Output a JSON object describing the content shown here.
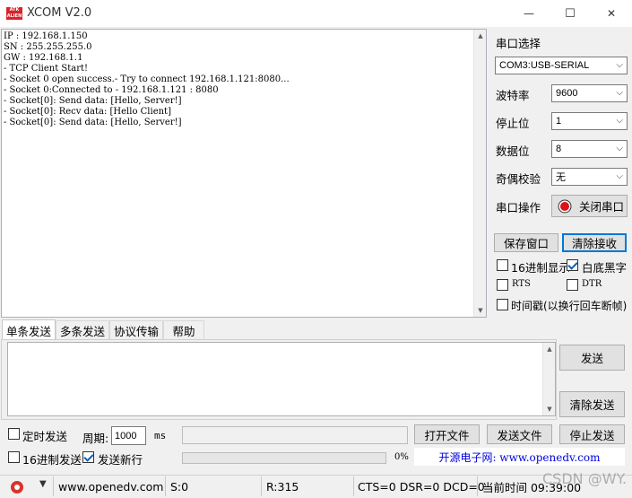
{
  "app": {
    "logo_text": "ATK ALIENTEK",
    "title": "XCOM V2.0",
    "minimize_glyph": "—",
    "maximize_glyph": "☐",
    "close_glyph": "✕"
  },
  "receive": {
    "text": "IP : 192.168.1.150\nSN : 255.255.255.0\nGW : 192.168.1.1\n- TCP Client Start!\n- Socket 0 open success.- Try to connect 192.168.1.121:8080...\n- Socket 0:Connected to - 192.168.1.121 : 8080\n- Socket[0]: Send data: [Hello, Server!]\n- Socket[0]: Recv data: [Hello Client]\n- Socket[0]: Send data: [Hello, Server!]"
  },
  "serial": {
    "section_label": "串口选择",
    "port_value": "COM3:USB-SERIAL",
    "baud_label": "波特率",
    "baud_value": "9600",
    "stop_label": "停止位",
    "stop_value": "1",
    "data_label": "数据位",
    "data_value": "8",
    "parity_label": "奇偶校验",
    "parity_value": "无",
    "op_label": "串口操作",
    "close_port_label": "关闭串口",
    "status_color": "#e0101a"
  },
  "actions": {
    "save_window": "保存窗口",
    "clear_receive": "清除接收"
  },
  "options": {
    "hex_display": "16进制显示",
    "hex_display_checked": false,
    "white_bg": "白底黑字",
    "white_bg_checked": true,
    "rts": "RTS",
    "rts_checked": false,
    "dtr": "DTR",
    "dtr_checked": false,
    "timestamp": "时间戳(以换行回车断帧)",
    "timestamp_checked": false
  },
  "tabs": [
    "单条发送",
    "多条发送",
    "协议传输",
    "帮助"
  ],
  "send": {
    "send_button": "发送",
    "clear_send_button": "清除发送",
    "timed_send": "定时发送",
    "timed_send_checked": false,
    "period_label": "周期:",
    "period_value": "1000",
    "period_unit": "ms",
    "open_file": "打开文件",
    "send_file": "发送文件",
    "stop_send": "停止发送",
    "hex_send": "16进制发送",
    "hex_send_checked": false,
    "send_newline": "发送新行",
    "send_newline_checked": true,
    "progress_text": "0%",
    "progress_value": 0,
    "promo": "开源电子网: www.openedv.com"
  },
  "statusbar": {
    "website": "www.openedv.com",
    "sent": "S:0",
    "received": "R:315",
    "lines": "CTS=0 DSR=0 DCD=0",
    "time": "当前时间 09:39:00",
    "watermark": "CSDN @WY."
  }
}
